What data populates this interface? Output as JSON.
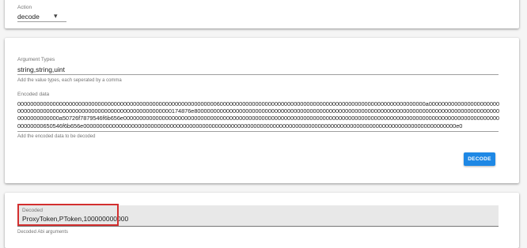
{
  "action": {
    "label": "Action",
    "value": "decode",
    "chevron_icon": "chevron-down-icon"
  },
  "argument_types": {
    "label": "Argument Types",
    "value": "string,string,uint",
    "helper": "Add the value types, each seperated by a comma"
  },
  "encoded_data": {
    "label": "Encoded data",
    "value": "0000000000000000000000000000000000000000000000000000000000000060000000000000000000000000000000000000000000000000000000000000000a0000000000000000000000000000000000000000000000000000000000000000000000174876e800000000000000000000000000000000000000000000000000000000000000000000000000000000000000000000000000000000000a50726f7879546f6b656e00000000000000000000000000000000000000000000000000000000000000000000000000000000000000000000000000000000000000000000000000000650546f6b656e00000000000000000000000000000000000000000000000000000000000000000000000000000000000000000000000000000000000000000000e0",
    "helper": "Add the encoded data to be decoded"
  },
  "decode_button": {
    "label": "DECODE",
    "color": "#1e88e5"
  },
  "decoded": {
    "label": "Decoded",
    "value": "ProxyToken,PToken,100000000000",
    "helper": "Decoded Abi arguments",
    "highlight_color": "#d32f2f"
  }
}
